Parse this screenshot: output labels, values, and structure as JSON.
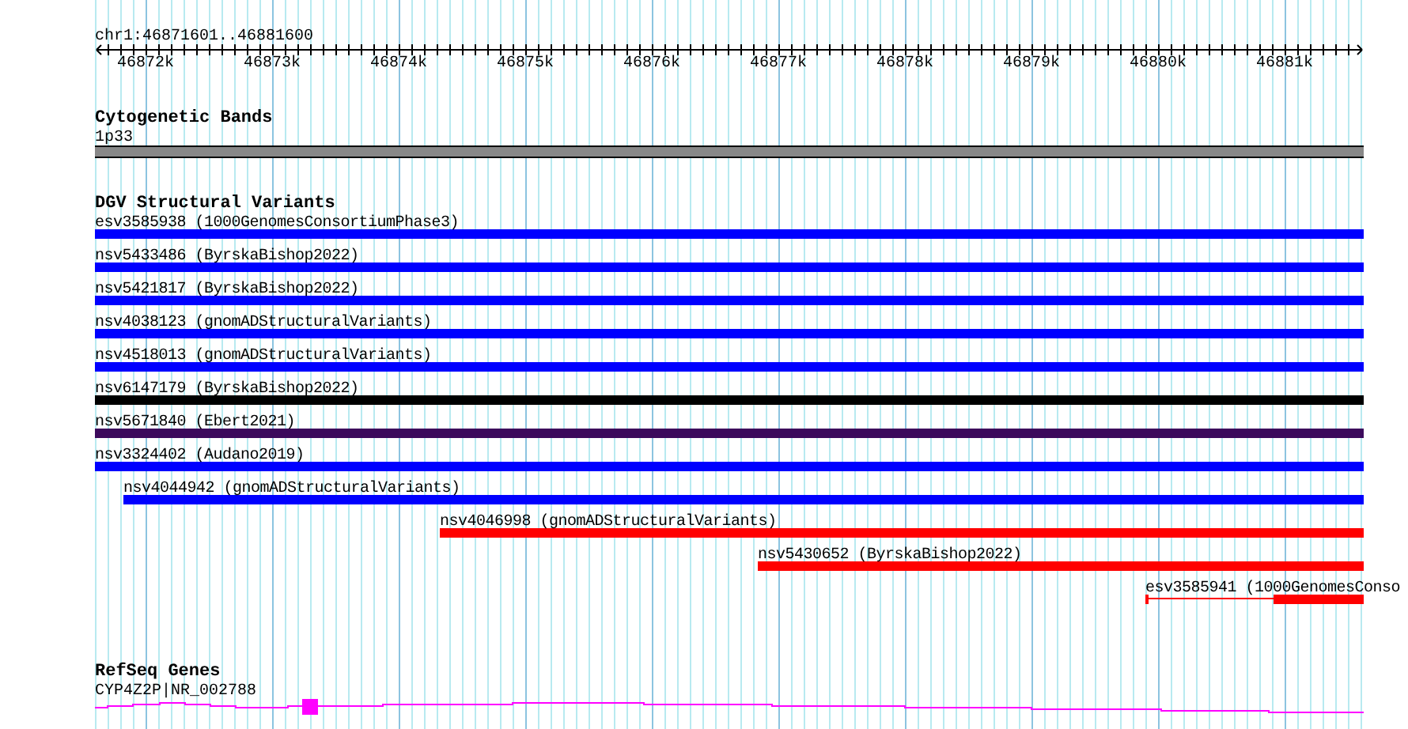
{
  "location": "chr1:46871601..46881600",
  "ruler": {
    "ticks": [
      "46872k",
      "46873k",
      "46874k",
      "46875k",
      "46876k",
      "46877k",
      "46878k",
      "46879k",
      "46880k",
      "46881k"
    ]
  },
  "cytobands": {
    "title": "Cytogenetic Bands",
    "features": [
      {
        "label": "1p33",
        "kind": "band"
      }
    ]
  },
  "variants": {
    "title": "DGV Structural Variants",
    "features": [
      {
        "label": "esv3585938 (1000GenomesConsortiumPhase3)",
        "kind": "solid",
        "color": "#0000ff"
      },
      {
        "label": "nsv5433486 (ByrskaBishop2022)",
        "kind": "solid",
        "color": "#0000ff"
      },
      {
        "label": "nsv5421817 (ByrskaBishop2022)",
        "kind": "solid",
        "color": "#0000ff"
      },
      {
        "label": "nsv4038123 (gnomADStructuralVariants)",
        "kind": "solid",
        "color": "#0000ff"
      },
      {
        "label": "nsv4518013 (gnomADStructuralVariants)",
        "kind": "solid",
        "color": "#0000ff"
      },
      {
        "label": "nsv6147179 (ByrskaBishop2022)",
        "kind": "solid",
        "color": "#000000"
      },
      {
        "label": "nsv5671840 (Ebert2021)",
        "kind": "solid",
        "color": "#3c0a5c"
      },
      {
        "label": "nsv3324402 (Audano2019)",
        "kind": "solid",
        "color": "#0000ff"
      },
      {
        "label": "nsv4044942 (gnomADStructuralVariants)",
        "kind": "solid",
        "color": "#0000ff"
      },
      {
        "label": "nsv4046998 (gnomADStructuralVariants)",
        "kind": "solid",
        "color": "#ff0000"
      },
      {
        "label": "nsv5430652 (ByrskaBishop2022)",
        "kind": "solid",
        "color": "#ff0000"
      },
      {
        "label": "esv3585941 (1000GenomesConso",
        "kind": "gapped",
        "color": "#ff0000"
      }
    ]
  },
  "genes": {
    "title": "RefSeq Genes",
    "features": [
      {
        "label": "CYP4Z2P|NR_002788",
        "kind": "gene"
      }
    ]
  }
}
